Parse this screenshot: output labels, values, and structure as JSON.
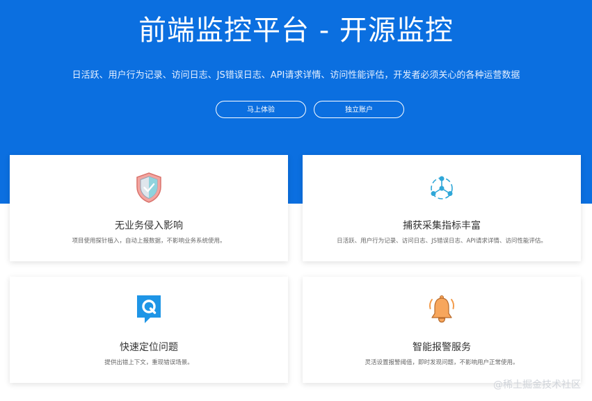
{
  "hero": {
    "title": "前端监控平台 - 开源监控",
    "subtitle": "日活跃、用户行为记录、访问日志、JS错误日志、API请求详情、访问性能评估，开发者必须关心的各种运营数据",
    "buttons": {
      "try_label": "马上体验",
      "account_label": "独立账户"
    },
    "background_color": "#0b6fe0"
  },
  "features": [
    {
      "icon": "shield-check-icon",
      "title": "无业务侵入影响",
      "description": "项目使用探针植入，自动上报数据，不影响业务系统使用。"
    },
    {
      "icon": "network-nodes-icon",
      "title": "捕获采集指标丰富",
      "description": "日活跃、用户行为记录、访问日志、JS错误日志、API请求详情、访问性能评估。"
    },
    {
      "icon": "q-chat-icon",
      "title": "快速定位问题",
      "description": "提供出错上下文，重现错误场景。"
    },
    {
      "icon": "bell-alarm-icon",
      "title": "智能报警服务",
      "description": "灵活设置报警阈值，即时发现问题，不影响用户正常使用。"
    }
  ],
  "watermark": "@稀土掘金技术社区"
}
